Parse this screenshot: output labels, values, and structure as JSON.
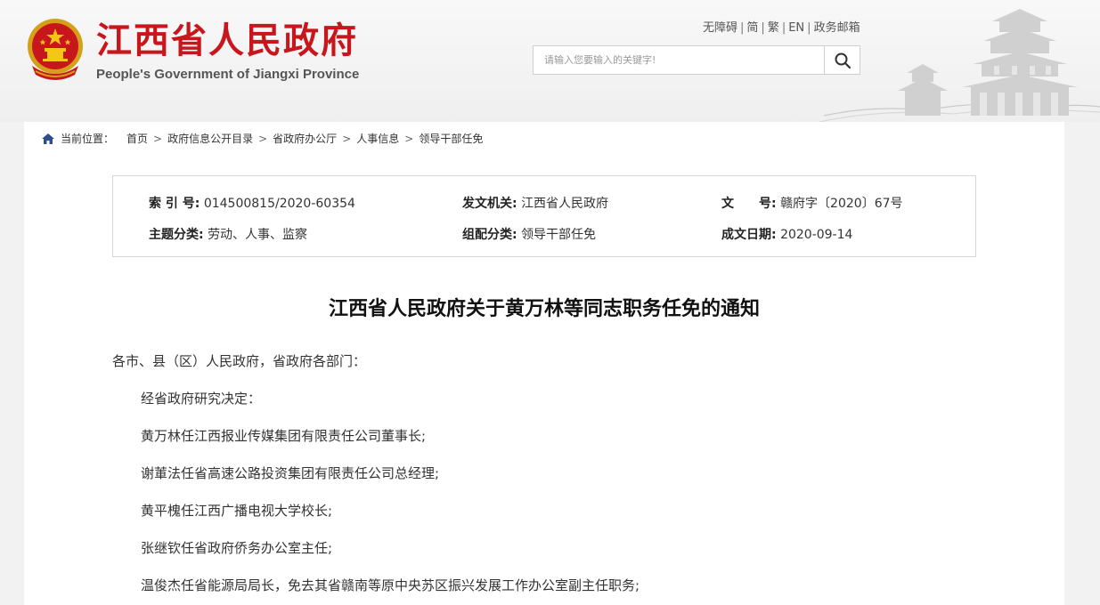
{
  "header": {
    "title": "江西省人民政府",
    "subtitle": "People's Government of Jiangxi Province",
    "links": [
      "无障碍",
      "简",
      "繁",
      "EN",
      "政务邮箱"
    ],
    "search": {
      "placeholder": "请输入您要输入的关键字!",
      "icon": "search-icon"
    },
    "colors": {
      "brand": "#c8161d"
    }
  },
  "breadcrumb": {
    "label": "当前位置：",
    "items": [
      "首页",
      "政府信息公开目录",
      "省政府办公厅",
      "人事信息",
      "领导干部任免"
    ]
  },
  "meta": {
    "index_label": "索 引 号:",
    "index_value": "014500815/2020-60354",
    "issuer_label": "发文机关:",
    "issuer_value": "江西省人民政府",
    "docno_label": "文　　号:",
    "docno_value": "赣府字〔2020〕67号",
    "topic_label": "主题分类:",
    "topic_value": "劳动、人事、监察",
    "category_label": "组配分类:",
    "category_value": "领导干部任免",
    "date_label": "成文日期:",
    "date_value": "2020-09-14"
  },
  "document": {
    "title": "江西省人民政府关于黄万林等同志职务任免的通知",
    "salutation": "各市、县（区）人民政府，省政府各部门：",
    "paragraphs": [
      "经省政府研究决定：",
      "黄万林任江西报业传媒集团有限责任公司董事长;",
      "谢莗法任省高速公路投资集团有限责任公司总经理;",
      "黄平槐任江西广播电视大学校长;",
      "张继钦任省政府侨务办公室主任;",
      "温俊杰任省能源局局长，免去其省赣南等原中央苏区振兴发展工作办公室副主任职务;"
    ]
  }
}
